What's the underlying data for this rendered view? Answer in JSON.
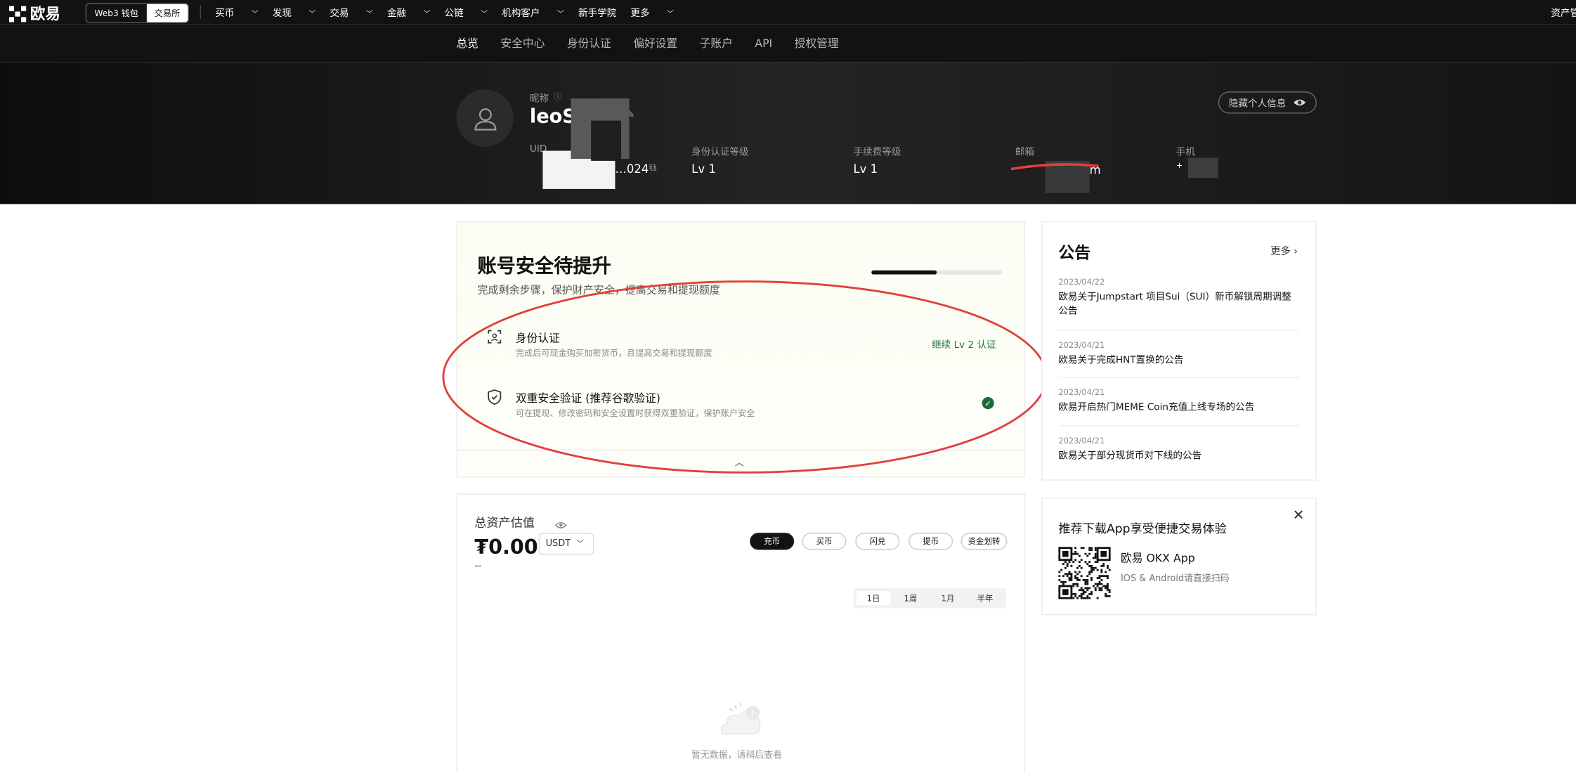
{
  "topnav": {
    "brand": "欧易",
    "toggle": [
      "Web3 钱包",
      "交易所"
    ],
    "menu": [
      "买币",
      "发现",
      "交易",
      "金融",
      "公链",
      "机构客户",
      "新手学院",
      "更多"
    ],
    "right_text": "资产管理"
  },
  "subnav": {
    "tabs": [
      "总览",
      "安全中心",
      "身份认证",
      "偏好设置",
      "子账户",
      "API",
      "授权管理"
    ],
    "active": "总览"
  },
  "profile": {
    "nickname_label": "昵称",
    "nickname": "leoSong",
    "hide_info": "隐藏个人信息",
    "fields": [
      {
        "label": "UID",
        "value": "…024"
      },
      {
        "label": "身份认证等级",
        "value": "Lv 1"
      },
      {
        "label": "手续费等级",
        "value": "Lv 1"
      },
      {
        "label": "邮箱",
        "value": "m"
      },
      {
        "label": "手机",
        "value": "+"
      }
    ]
  },
  "security": {
    "title": "账号安全待提升",
    "subtitle": "完成剩余步骤，保护财产安全，提高交易和提现额度",
    "progress": 0.5,
    "items": [
      {
        "title": "身份认证",
        "desc": "完成后可现金购买加密货币，且提高交易和提现额度",
        "action": "继续 Lv 2 认证",
        "icon": "face-scan-icon"
      },
      {
        "title": "双重安全验证 (推荐谷歌验证)",
        "desc": "可在提现、修改密码和安全设置时获得双重验证，保护账户安全",
        "status": "done",
        "icon": "shield-icon"
      }
    ]
  },
  "assets": {
    "title": "总资产估值",
    "amount": "₮0.00",
    "currency": "USDT",
    "sub": "--",
    "actions": [
      "充币",
      "买币",
      "闪兑",
      "提币",
      "资金划转"
    ],
    "ranges": [
      "1日",
      "1周",
      "1月",
      "半年"
    ],
    "active_range": "1日",
    "empty": "暂无数据，请稍后查看"
  },
  "announcements": {
    "title": "公告",
    "more": "更多",
    "items": [
      {
        "date": "2023/04/22",
        "text": "欧易关于Jumpstart 项目Sui（SUI）新币解锁周期调整公告"
      },
      {
        "date": "2023/04/21",
        "text": "欧易关于完成HNT置换的公告"
      },
      {
        "date": "2023/04/21",
        "text": "欧易开启热门MEME Coin充值上线专场的公告"
      },
      {
        "date": "2023/04/21",
        "text": "欧易关于部分现货币对下线的公告"
      }
    ]
  },
  "app_promo": {
    "title": "推荐下载App享受便捷交易体验",
    "app_name": "欧易 OKX App",
    "hint": "IOS & Android请直接扫码"
  },
  "colors": {
    "annotation": "#e0403c",
    "success": "#1e6b3a",
    "action_text": "#1f7a3a"
  }
}
